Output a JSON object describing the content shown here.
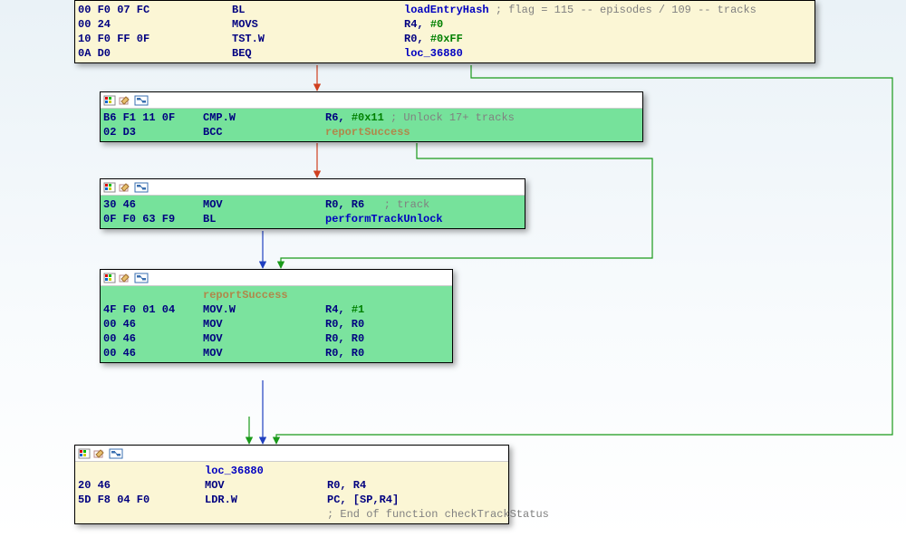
{
  "block1": {
    "rows": [
      {
        "hex": "00 F0 07 FC",
        "mnem": "BL",
        "ops": [
          {
            "t": "sym",
            "v": "loadEntryHash"
          }
        ],
        "comment": " ; flag = 115 -- episodes / 109 -- tracks"
      },
      {
        "hex": "00 24",
        "mnem": "MOVS",
        "ops": [
          {
            "t": "reg",
            "v": "R4, "
          },
          {
            "t": "num",
            "v": "#0"
          }
        ]
      },
      {
        "hex": "10 F0 FF 0F",
        "mnem": "TST.W",
        "ops": [
          {
            "t": "reg",
            "v": "R0, "
          },
          {
            "t": "num",
            "v": "#0xFF"
          }
        ]
      },
      {
        "hex": "0A D0",
        "mnem": "BEQ",
        "ops": [
          {
            "t": "sym",
            "v": "loc_36880"
          }
        ]
      }
    ]
  },
  "block2": {
    "rows": [
      {
        "hex": "B6 F1 11 0F",
        "mnem": "CMP.W",
        "ops": [
          {
            "t": "reg",
            "v": "R6, "
          },
          {
            "t": "num",
            "v": "#0x11"
          }
        ],
        "comment": " ; Unlock 17+ tracks"
      },
      {
        "hex": "02 D3",
        "mnem": "BCC",
        "ops": [
          {
            "t": "label",
            "v": "reportSuccess"
          }
        ]
      }
    ]
  },
  "block3": {
    "rows": [
      {
        "hex": "30 46",
        "mnem": "MOV",
        "ops": [
          {
            "t": "reg",
            "v": "R0, R6  "
          }
        ],
        "comment": " ; track"
      },
      {
        "hex": "0F F0 63 F9",
        "mnem": "BL",
        "ops": [
          {
            "t": "sym",
            "v": "performTrackUnlock"
          }
        ]
      }
    ]
  },
  "block4": {
    "label": "reportSuccess",
    "rows": [
      {
        "hex": "4F F0 01 04",
        "mnem": "MOV.W",
        "ops": [
          {
            "t": "reg",
            "v": "R4, "
          },
          {
            "t": "num",
            "v": "#1"
          }
        ]
      },
      {
        "hex": "00 46",
        "mnem": "MOV",
        "ops": [
          {
            "t": "reg",
            "v": "R0, R0"
          }
        ]
      },
      {
        "hex": "00 46",
        "mnem": "MOV",
        "ops": [
          {
            "t": "reg",
            "v": "R0, R0"
          }
        ]
      },
      {
        "hex": "00 46",
        "mnem": "MOV",
        "ops": [
          {
            "t": "reg",
            "v": "R0, R0"
          }
        ]
      }
    ]
  },
  "block5": {
    "label": "loc_36880",
    "rows": [
      {
        "hex": "20 46",
        "mnem": "MOV",
        "ops": [
          {
            "t": "reg",
            "v": "R0, R4"
          }
        ]
      },
      {
        "hex": "5D F8 04 F0",
        "mnem": "LDR.W",
        "ops": [
          {
            "t": "reg",
            "v": "PC, [SP,R4]"
          }
        ]
      }
    ],
    "end_comment": "; End of function checkTrackStatus"
  }
}
